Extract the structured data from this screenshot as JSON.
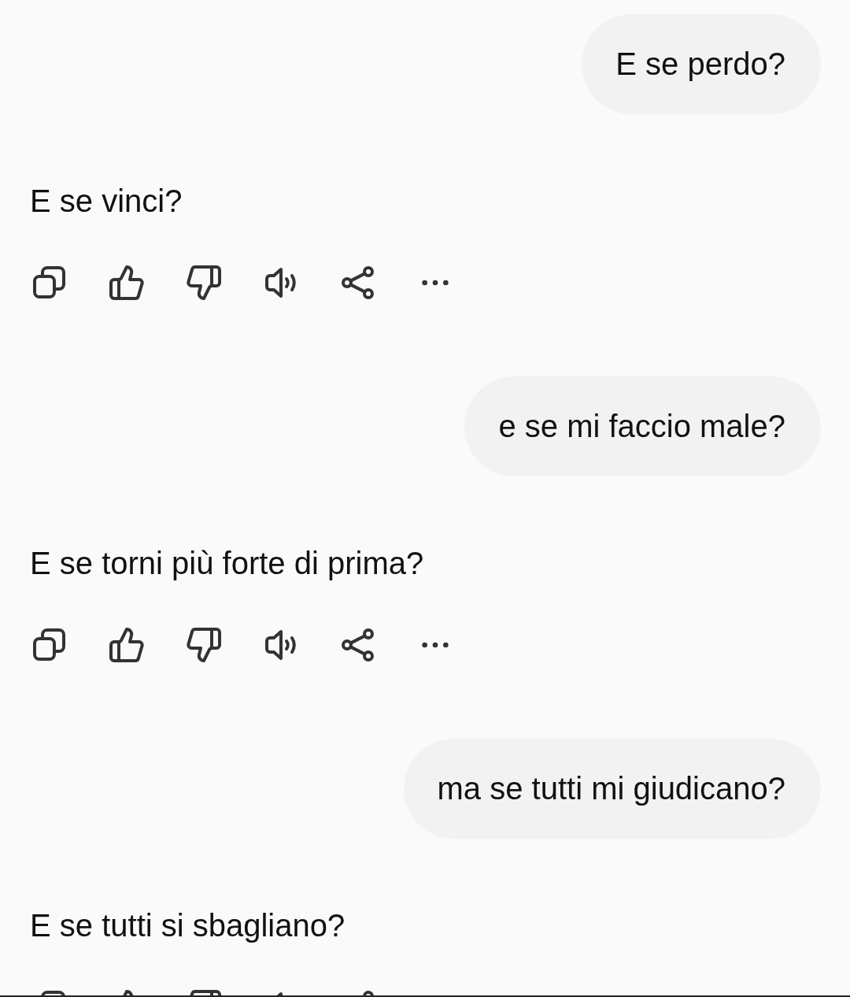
{
  "messages": [
    {
      "kind": "user",
      "text": "E se perdo?"
    },
    {
      "kind": "assistant",
      "text": "E se vinci?"
    },
    {
      "kind": "user",
      "text": "e se mi faccio male?"
    },
    {
      "kind": "assistant",
      "text": "E se torni più forte di prima?"
    },
    {
      "kind": "user",
      "text": "ma se tutti mi giudicano?"
    },
    {
      "kind": "assistant",
      "text": "E se tutti si sbagliano?"
    }
  ]
}
